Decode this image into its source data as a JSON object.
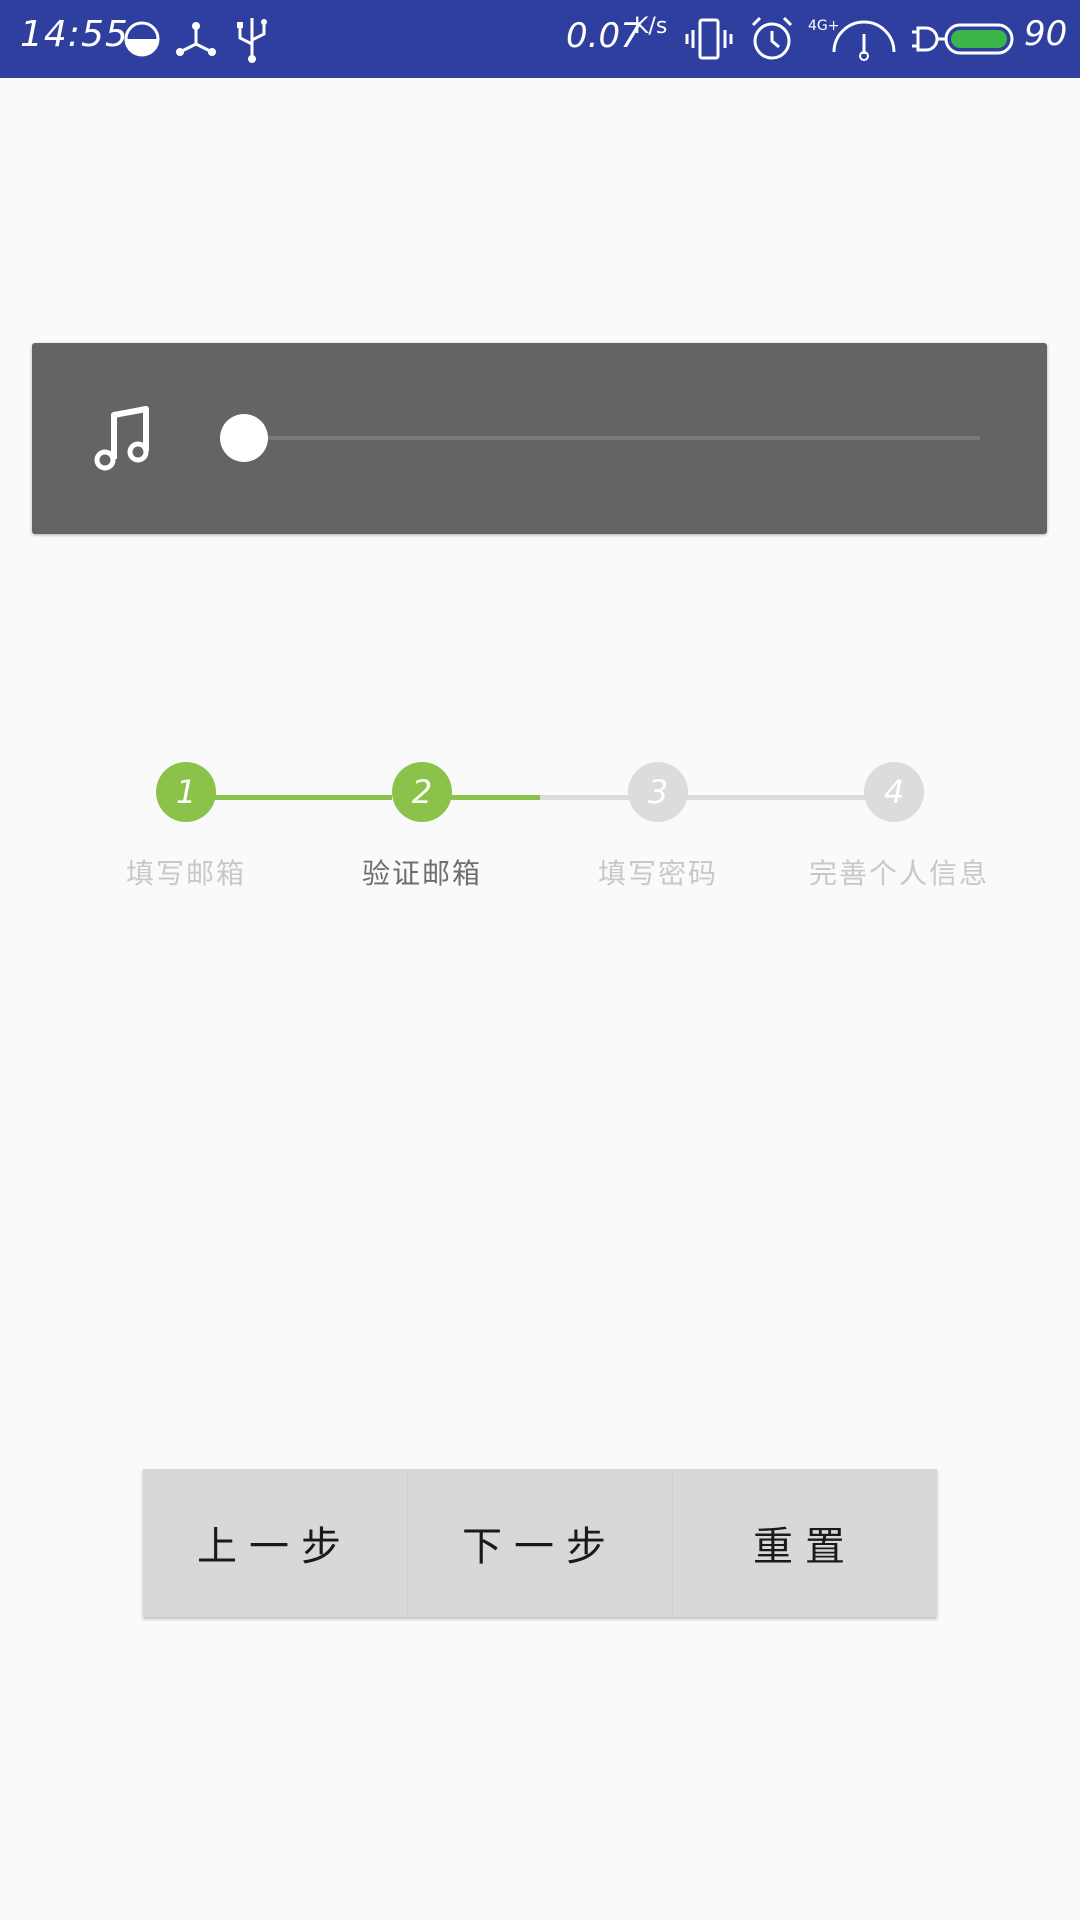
{
  "status_bar": {
    "time": "14:55",
    "net_speed": "0.07",
    "net_speed_unit": "K/s",
    "battery_level": "90",
    "network_type": "4G+",
    "icons": [
      "data-saver-icon",
      "share-icon",
      "usb-icon",
      "vibrate-icon",
      "alarm-icon",
      "signal-icon",
      "battery-icon"
    ]
  },
  "music_player": {
    "icon": "music-note-icon",
    "progress": 0.0
  },
  "stepper": {
    "steps": [
      {
        "number": "1",
        "label": "填写邮箱"
      },
      {
        "number": "2",
        "label": "验证邮箱"
      },
      {
        "number": "3",
        "label": "填写密码"
      },
      {
        "number": "4",
        "label": "完善个人信息"
      }
    ],
    "current_step": 2,
    "colors": {
      "active": "#8bc34a",
      "inactive": "#dcdcdc",
      "label_active": "#6e6e6e",
      "label_inactive": "#c8c8c8"
    }
  },
  "buttons": {
    "prev": "上一步",
    "next": "下一步",
    "reset": "重置"
  },
  "colors": {
    "status_bar_bg": "#2e3f9f",
    "card_bg": "#646464",
    "page_bg": "#fafafa",
    "button_group_bg": "#d7d8d7"
  }
}
